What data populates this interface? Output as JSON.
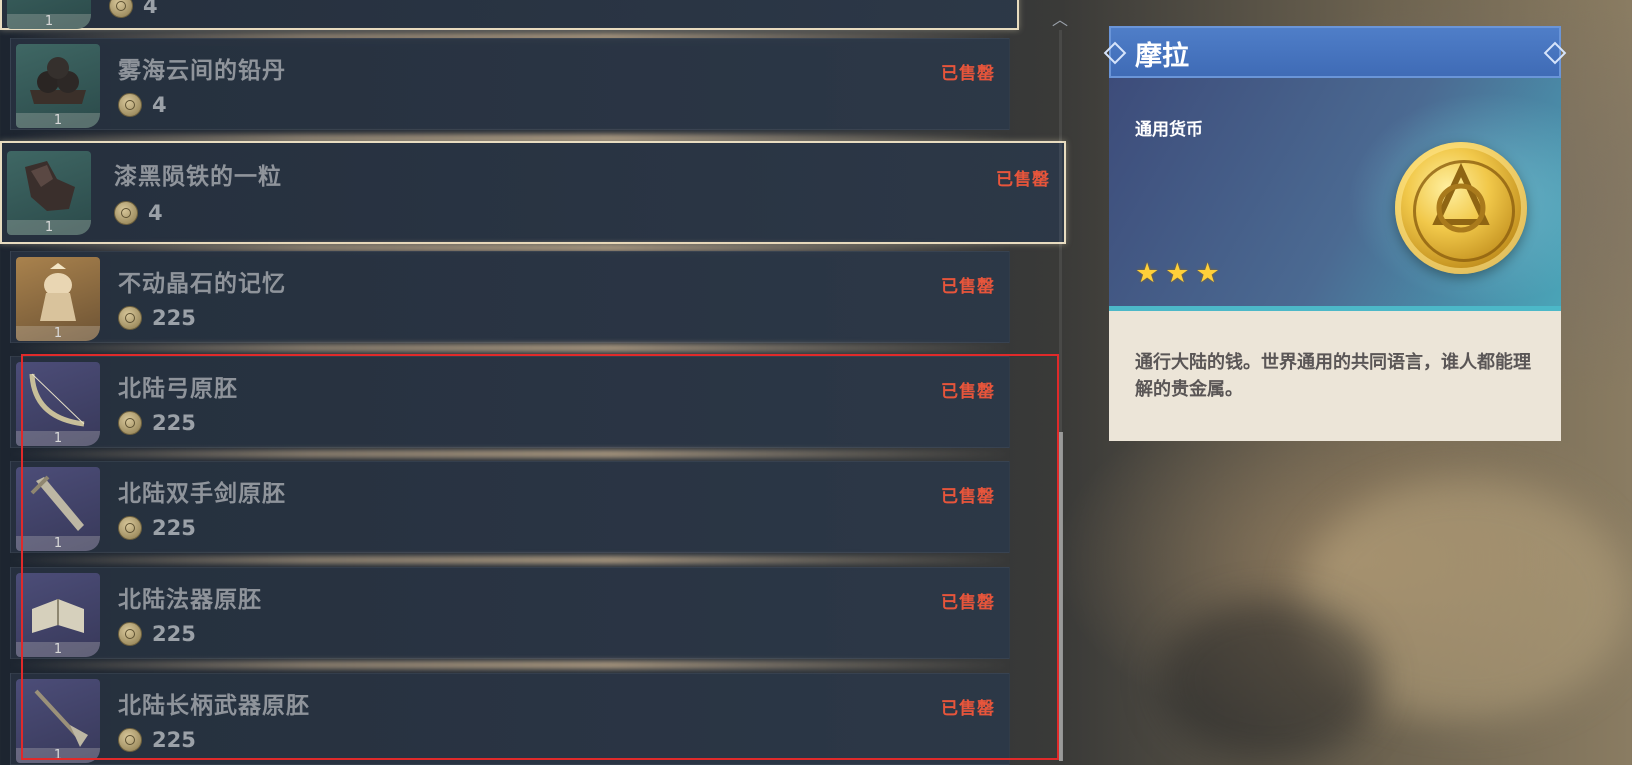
{
  "shop_list": {
    "items": [
      {
        "name": "",
        "price": "4",
        "count": "1",
        "status": "",
        "thumb": "green",
        "icon": "item-icon"
      },
      {
        "name": "雾海云间的铅丹",
        "price": "4",
        "count": "1",
        "status": "已售罄",
        "thumb": "green",
        "icon": "cannonballs-icon"
      },
      {
        "name": "漆黑陨铁的一粒",
        "price": "4",
        "count": "1",
        "status": "已售罄",
        "thumb": "green",
        "icon": "iron-chunk-icon"
      },
      {
        "name": "不动晶石的记忆",
        "price": "225",
        "count": "1",
        "status": "已售罄",
        "thumb": "gold",
        "icon": "crystal-memory-icon"
      },
      {
        "name": "北陆弓原胚",
        "price": "225",
        "count": "1",
        "status": "已售罄",
        "thumb": "purple",
        "icon": "bow-icon"
      },
      {
        "name": "北陆双手剑原胚",
        "price": "225",
        "count": "1",
        "status": "已售罄",
        "thumb": "purple",
        "icon": "claymore-icon"
      },
      {
        "name": "北陆法器原胚",
        "price": "225",
        "count": "1",
        "status": "已售罄",
        "thumb": "purple",
        "icon": "catalyst-book-icon"
      },
      {
        "name": "北陆长柄武器原胚",
        "price": "225",
        "count": "1",
        "status": "已售罄",
        "thumb": "purple",
        "icon": "polearm-icon"
      }
    ]
  },
  "detail": {
    "title": "摩拉",
    "type": "通用货币",
    "rarity_stars": 3,
    "description": "通行大陆的钱。世界通用的共同语言，谁人都能理解的贵金属。",
    "icon": "mora-coin-icon"
  },
  "colors": {
    "sold_out": "#e7553b",
    "title_bar": "#4f7ec8",
    "highlight_box": "#e02a2a",
    "star": "#ffd03a"
  }
}
